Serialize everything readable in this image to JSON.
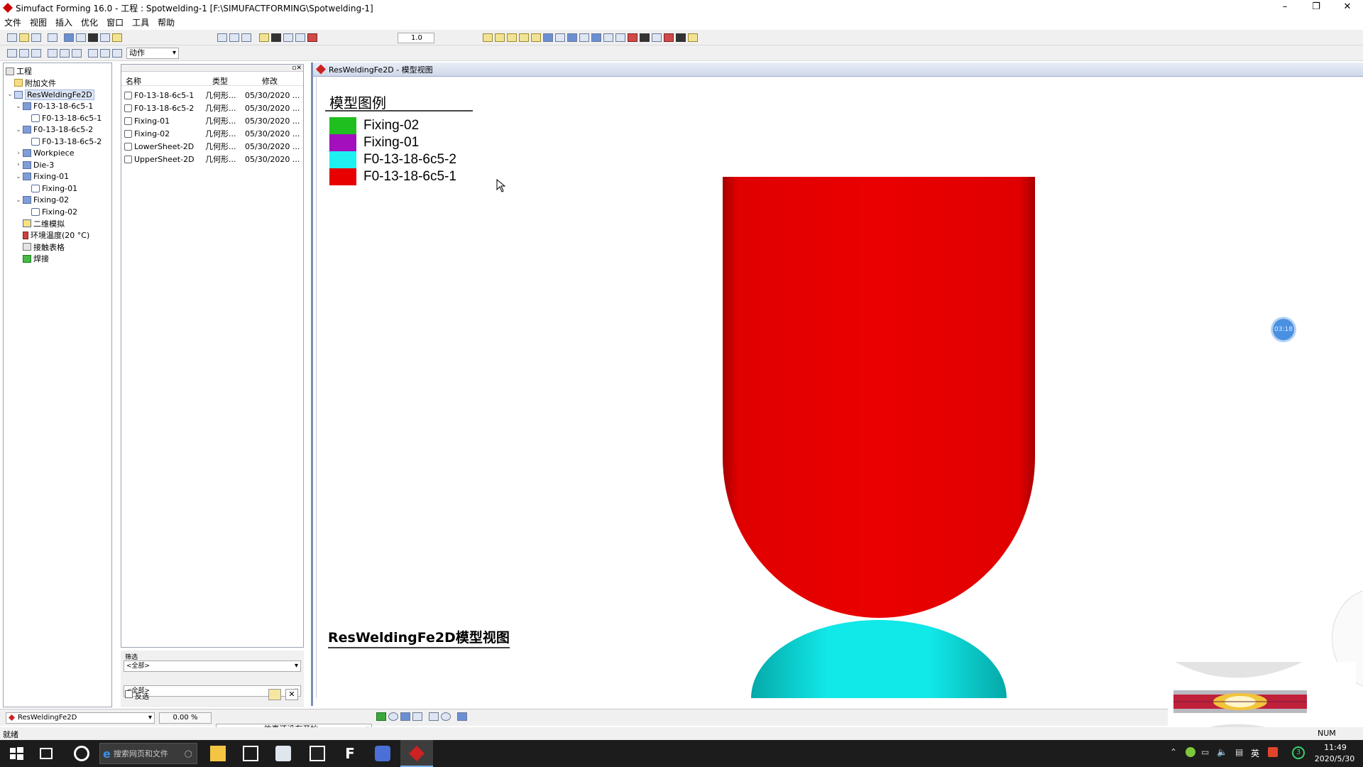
{
  "window": {
    "title": "Simufact Forming 16.0 - 工程 : Spotwelding-1 [F:\\SIMUFACTFORMING\\Spotwelding-1]",
    "min_glyph": "–",
    "restore_glyph": "❐",
    "close_glyph": "✕"
  },
  "menu": [
    "文件",
    "视图",
    "插入",
    "优化",
    "窗口",
    "工具",
    "帮助"
  ],
  "toolbar": {
    "zoom_value": "1.0",
    "action_select": "动作"
  },
  "tree": {
    "root": "工程",
    "items": [
      {
        "label": "附加文件",
        "indent": 1,
        "icon": "folder"
      },
      {
        "label": "ResWeldingFe2D",
        "indent": 1,
        "icon": "project",
        "expanded": true,
        "selected": true
      },
      {
        "label": "F0-13-18-6c5-1",
        "indent": 2,
        "icon": "part",
        "expanded": true
      },
      {
        "label": "F0-13-18-6c5-1",
        "indent": 3,
        "icon": "geo"
      },
      {
        "label": "F0-13-18-6c5-2",
        "indent": 2,
        "icon": "part",
        "expanded": true
      },
      {
        "label": "F0-13-18-6c5-2",
        "indent": 3,
        "icon": "geo"
      },
      {
        "label": "Workpiece",
        "indent": 2,
        "icon": "part",
        "expanded": false
      },
      {
        "label": "Die-3",
        "indent": 2,
        "icon": "part",
        "expanded": false
      },
      {
        "label": "Fixing-01",
        "indent": 2,
        "icon": "part",
        "expanded": true
      },
      {
        "label": "Fixing-01",
        "indent": 3,
        "icon": "geo"
      },
      {
        "label": "Fixing-02",
        "indent": 2,
        "icon": "part",
        "expanded": true
      },
      {
        "label": "Fixing-02",
        "indent": 3,
        "icon": "geo"
      },
      {
        "label": "二维模拟",
        "indent": 2,
        "icon": "sim"
      },
      {
        "label": "环境温度(20 °C)",
        "indent": 2,
        "icon": "temp"
      },
      {
        "label": "接触表格",
        "indent": 2,
        "icon": "table"
      },
      {
        "label": "焊接",
        "indent": 2,
        "icon": "green"
      }
    ]
  },
  "list": {
    "headers": [
      "名称",
      "类型",
      "修改"
    ],
    "rows": [
      [
        "F0-13-18-6c5-1",
        "几何形...",
        "05/30/2020 ..."
      ],
      [
        "F0-13-18-6c5-2",
        "几何形...",
        "05/30/2020 ..."
      ],
      [
        "Fixing-01",
        "几何形...",
        "05/30/2020 ..."
      ],
      [
        "Fixing-02",
        "几何形...",
        "05/30/2020 ..."
      ],
      [
        "LowerSheet-2D",
        "几何形...",
        "05/30/2020 ..."
      ],
      [
        "UpperSheet-2D",
        "几何形...",
        "05/30/2020 ..."
      ]
    ],
    "filter_label": "筛选",
    "filter1": "<全部>",
    "filter2": "<全部>",
    "invert_label": "反选"
  },
  "model_view": {
    "window_title": "ResWeldingFe2D - 模型视图",
    "legend_title": "模型图例",
    "legend": [
      {
        "label": "Fixing-02",
        "color": "#1fbf1f"
      },
      {
        "label": "Fixing-01",
        "color": "#a30fbd"
      },
      {
        "label": "F0-13-18-6c5-2",
        "color": "#1ff0f0"
      },
      {
        "label": "F0-13-18-6c5-1",
        "color": "#e80000"
      }
    ],
    "caption": "ResWeldingFe2D模型视图",
    "timer": "03:18"
  },
  "statusbar": {
    "project_select": "ResWeldingFe2D",
    "progress": "0.00 %",
    "sim_status": "仿真还没有开始。",
    "ready": "就绪",
    "num": "NUM"
  },
  "taskbar": {
    "search_placeholder": "搜索网页和文件",
    "time": "11:49",
    "date": "2020/5/30",
    "ime": "英",
    "badge": "3"
  }
}
